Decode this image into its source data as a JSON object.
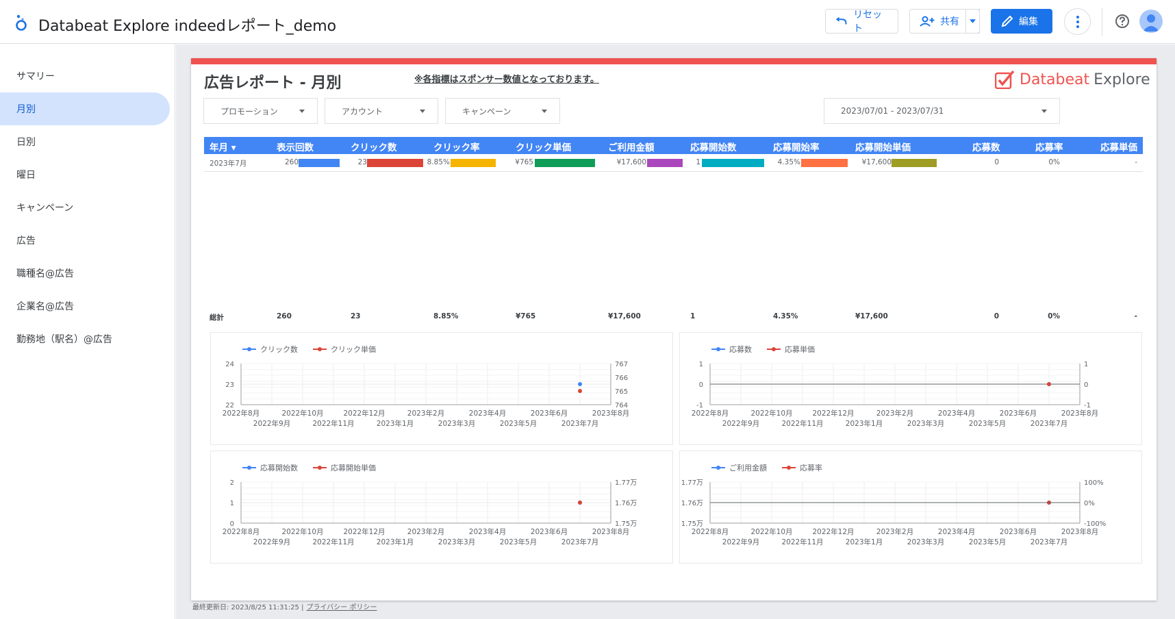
{
  "app": {
    "title": "Databeat Explore indeedレポート_demo",
    "reset_label": "リセット",
    "share_label": "共有",
    "edit_label": "編集"
  },
  "sidebar": {
    "items": [
      {
        "label": "サマリー"
      },
      {
        "label": "月別"
      },
      {
        "label": "日別"
      },
      {
        "label": "曜日"
      },
      {
        "label": "キャンペーン"
      },
      {
        "label": "広告"
      },
      {
        "label": "職種名@広告"
      },
      {
        "label": "企業名@広告"
      },
      {
        "label": "勤務地（駅名）@広告"
      }
    ],
    "active_index": 1
  },
  "report": {
    "title": "広告レポート - 月別",
    "note": "※各指標はスポンサー数値となっております。",
    "brand_part1": "Databeat",
    "brand_part2": "Explore",
    "filters": {
      "promotion": "プロモーション",
      "account": "アカウント",
      "campaign": "キャンペーン",
      "date_range": "2023/07/01 - 2023/07/31"
    }
  },
  "table": {
    "headers": [
      "年月 ▾",
      "表示回数",
      "クリック数",
      "クリック率",
      "クリック単価",
      "ご利用金額",
      "応募開始数",
      "応募開始率",
      "応募開始単価",
      "応募数",
      "応募率",
      "応募単価"
    ],
    "row": [
      "2023年7月",
      "260",
      "23",
      "8.85%",
      "¥765",
      "¥17,600",
      "1",
      "4.35%",
      "¥17,600",
      "0",
      "0%",
      "-"
    ],
    "totals": [
      "総計",
      "260",
      "23",
      "8.85%",
      "¥765",
      "¥17,600",
      "1",
      "4.35%",
      "¥17,600",
      "0",
      "0%",
      "-"
    ],
    "bar_colors": [
      "#4285f4",
      "#db4437",
      "#f4b400",
      "#0f9d58",
      "#ab47bc",
      "#00acc1",
      "#ff7043",
      "#9e9d24"
    ]
  },
  "x_axis": {
    "top_labels": [
      "2022年8月",
      "2022年10月",
      "2022年12月",
      "2023年2月",
      "2023年4月",
      "2023年6月",
      "2023年8月"
    ],
    "bottom_labels": [
      "2022年9月",
      "2022年11月",
      "2023年1月",
      "2023年3月",
      "2023年5月",
      "2023年7月"
    ]
  },
  "chart_data": [
    {
      "type": "line",
      "series": [
        {
          "name": "クリック数",
          "color": "#4285f4",
          "x": [
            "2023年7月"
          ],
          "values": [
            23
          ]
        },
        {
          "name": "クリック単価",
          "color": "#db4437",
          "x": [
            "2023年7月"
          ],
          "values": [
            765
          ]
        }
      ],
      "y_left_ticks": [
        "24",
        "23",
        "22"
      ],
      "y_right_ticks": [
        "767",
        "766",
        "765",
        "764"
      ],
      "ylim_left": [
        22,
        24
      ],
      "ylim_right": [
        764,
        767
      ]
    },
    {
      "type": "line",
      "series": [
        {
          "name": "応募数",
          "color": "#4285f4",
          "x": [
            "2023年7月"
          ],
          "values": [
            0
          ]
        },
        {
          "name": "応募単価",
          "color": "#db4437",
          "x": [
            "2023年7月"
          ],
          "values": [
            0
          ]
        }
      ],
      "y_left_ticks": [
        "1",
        "0",
        "-1"
      ],
      "y_right_ticks": [
        "1",
        "0",
        "-1"
      ],
      "ylim_left": [
        -1,
        1
      ],
      "ylim_right": [
        -1,
        1
      ]
    },
    {
      "type": "line",
      "series": [
        {
          "name": "応募開始数",
          "color": "#4285f4",
          "x": [
            "2023年7月"
          ],
          "values": [
            1
          ]
        },
        {
          "name": "応募開始単価",
          "color": "#db4437",
          "x": [
            "2023年7月"
          ],
          "values": [
            17600
          ]
        }
      ],
      "y_left_ticks": [
        "2",
        "1",
        "0"
      ],
      "y_right_ticks": [
        "1.77万",
        "1.76万",
        "1.75万"
      ],
      "ylim_left": [
        0,
        2
      ],
      "ylim_right": [
        17500,
        17700
      ]
    },
    {
      "type": "line",
      "series": [
        {
          "name": "ご利用金額",
          "color": "#4285f4",
          "x": [
            "2023年7月"
          ],
          "values": [
            17600
          ]
        },
        {
          "name": "応募率",
          "color": "#db4437",
          "x": [
            "2023年7月"
          ],
          "values": [
            0
          ]
        }
      ],
      "y_left_ticks": [
        "1.77万",
        "1.76万",
        "1.75万"
      ],
      "y_right_ticks": [
        "100%",
        "0%",
        "-100%"
      ],
      "ylim_left": [
        17500,
        17700
      ],
      "ylim_right": [
        -100,
        100
      ]
    }
  ],
  "footer": {
    "updated": "最終更新日: 2023/8/25 11:31:25 |",
    "privacy": "プライバシー ポリシー"
  }
}
